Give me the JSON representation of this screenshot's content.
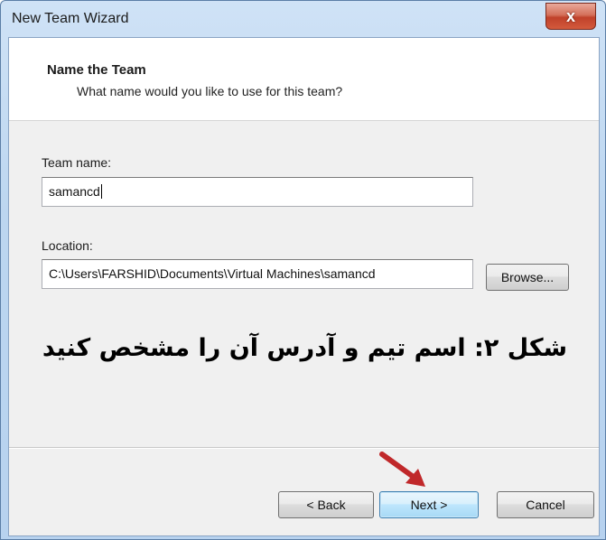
{
  "window": {
    "title": "New Team Wizard",
    "close_glyph": "x"
  },
  "header": {
    "title": "Name the Team",
    "subtitle": "What name would you like to use for this team?"
  },
  "form": {
    "team_name_label": "Team name:",
    "team_name_value": "samancd",
    "location_label": "Location:",
    "location_value": "C:\\Users\\FARSHID\\Documents\\Virtual Machines\\samancd",
    "browse_label": "Browse..."
  },
  "annotation": {
    "caption": "شکل ۲: اسم تیم و آدرس آن را مشخص کنید",
    "arrow_color": "#c0282a"
  },
  "footer": {
    "back_label": "< Back",
    "next_label": "Next >",
    "cancel_label": "Cancel"
  }
}
